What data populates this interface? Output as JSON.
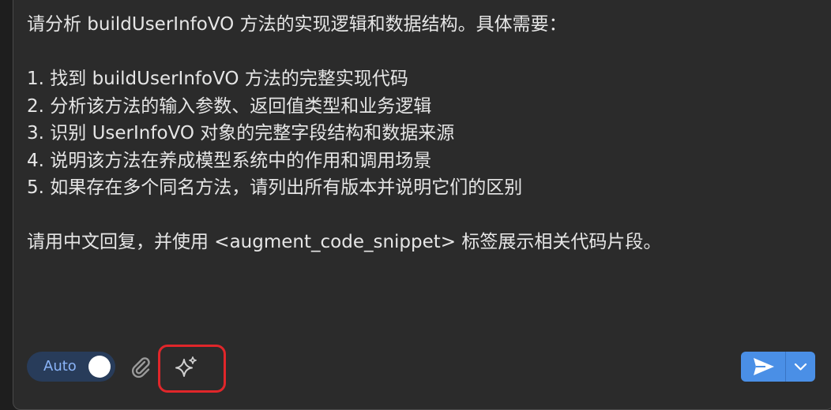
{
  "message": {
    "lines": [
      "请分析 buildUserInfoVO 方法的实现逻辑和数据结构。具体需要：",
      "",
      "1. 找到 buildUserInfoVO 方法的完整实现代码",
      "2. 分析该方法的输入参数、返回值类型和业务逻辑",
      "3. 识别 UserInfoVO 对象的完整字段结构和数据来源",
      "4. 说明该方法在养成模型系统中的作用和调用场景",
      "5. 如果存在多个同名方法，请列出所有版本并说明它们的区别",
      "",
      "请用中文回复，并使用 <augment_code_snippet> 标签展示相关代码片段。"
    ]
  },
  "toolbar": {
    "auto_label": "Auto",
    "auto_enabled": true,
    "attach_icon": "paperclip-icon",
    "enhance_icon": "sparkle-icon",
    "send_icon": "paper-plane-icon",
    "dropdown_icon": "chevron-down-icon"
  },
  "colors": {
    "background": "#2b2b2b",
    "text": "#e6e6e6",
    "accent": "#4a8fe6",
    "toggle_bg": "#283c5a",
    "toggle_text": "#8ab4f8",
    "highlight": "#e0262a"
  }
}
